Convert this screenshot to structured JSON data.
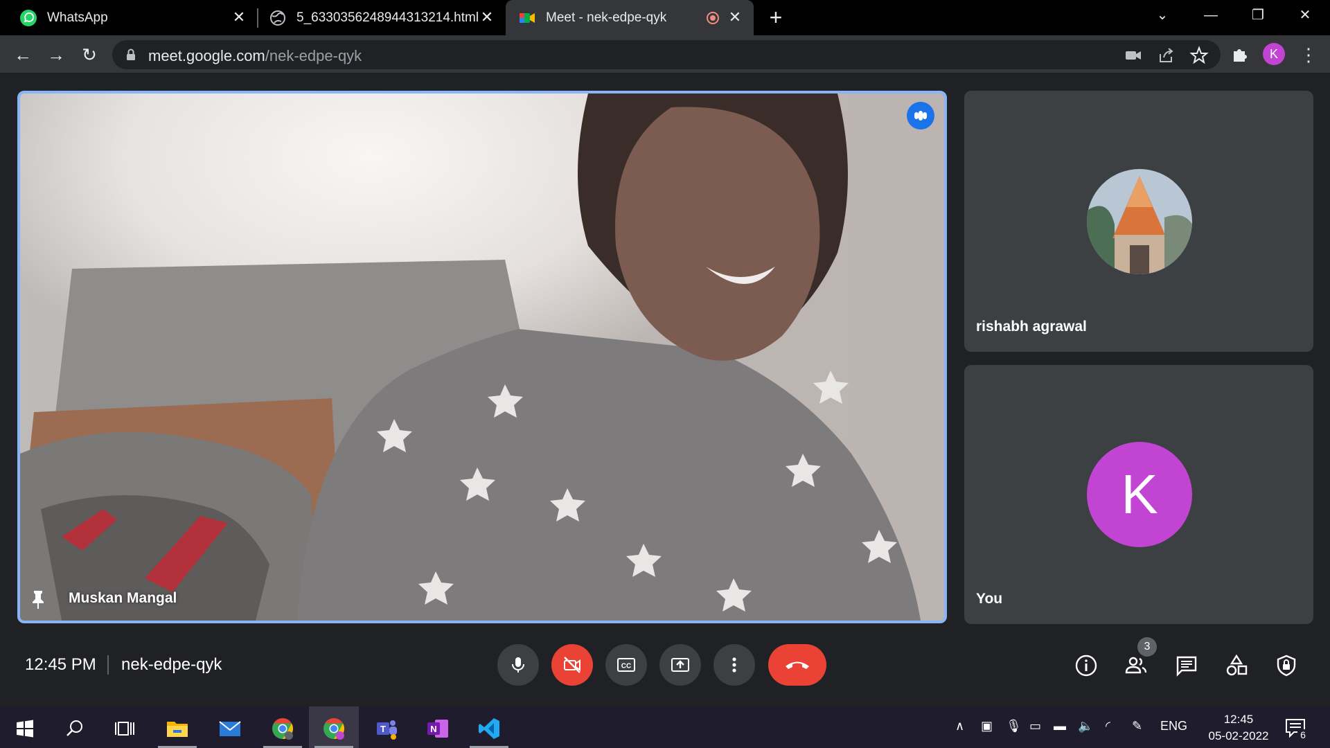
{
  "browser": {
    "tabs": [
      {
        "title": "WhatsApp",
        "icon": "whatsapp-icon",
        "active": false
      },
      {
        "title": "5_6330356248944313214.html",
        "icon": "globe-icon",
        "active": false
      },
      {
        "title": "Meet - nek-edpe-qyk",
        "icon": "google-meet-icon",
        "active": true,
        "recording_indicator": true
      }
    ],
    "new_tab_label": "+",
    "url_host": "meet.google.com",
    "url_path": "/nek-edpe-qyk",
    "profile_initial": "K"
  },
  "meet": {
    "main_participant": {
      "name": "Muskan Mangal",
      "pinned": true,
      "speaking": true
    },
    "side_participants": [
      {
        "name": "rishabh agrawal",
        "avatar": "temple-photo"
      },
      {
        "name": "You",
        "avatar_initial": "K",
        "avatar_color": "#c244d2"
      }
    ],
    "time": "12:45 PM",
    "meeting_code": "nek-edpe-qyk",
    "participants_count": "3",
    "controls": [
      "microphone-icon",
      "camera-off-icon",
      "captions-icon",
      "present-screen-icon",
      "more-options-icon",
      "hang-up-icon"
    ],
    "right_controls": [
      "info-icon",
      "people-icon",
      "chat-icon",
      "activities-icon",
      "host-controls-icon"
    ]
  },
  "taskbar": {
    "apps": [
      "windows-start",
      "search",
      "task-view",
      "file-explorer",
      "mail",
      "chrome",
      "chrome-profile",
      "teams",
      "onenote",
      "vscode"
    ],
    "language": "ENG",
    "time": "12:45",
    "date": "05-02-2022",
    "notification_count": "6"
  },
  "colors": {
    "meet_bg": "#202124",
    "tile_bg": "#3c4043",
    "active_border": "#8ab4f8",
    "danger": "#ea4335",
    "avatar": "#c244d2"
  }
}
